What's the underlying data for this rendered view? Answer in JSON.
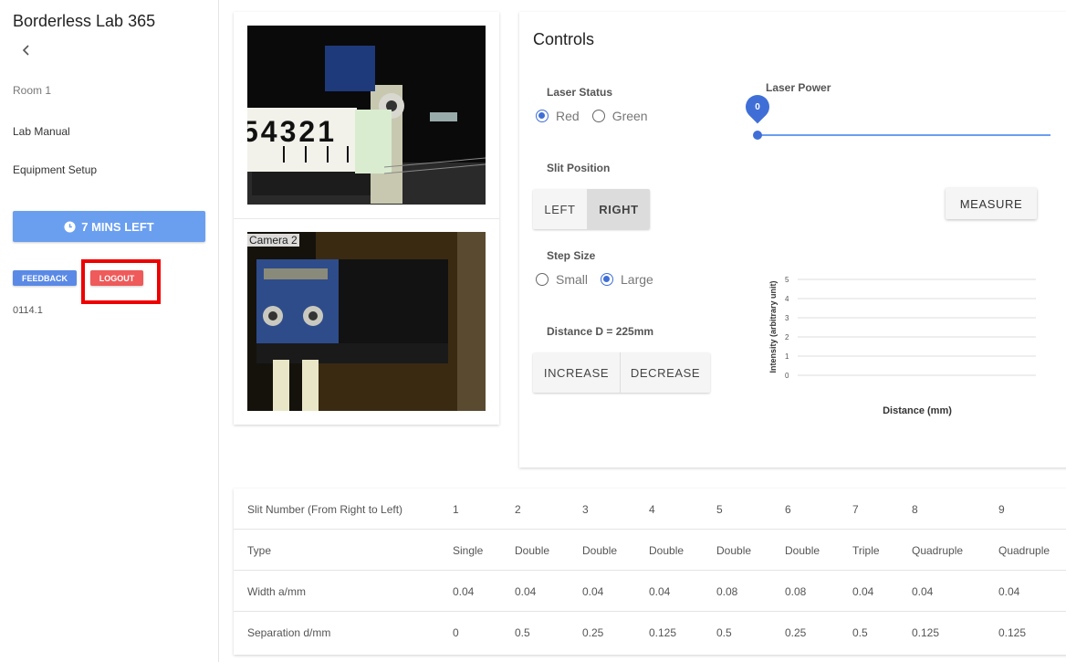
{
  "sidebar": {
    "app_title": "Borderless Lab 365",
    "back_icon": "chevron-left-icon",
    "room": "Room 1",
    "links": [
      "Lab Manual",
      "Equipment Setup"
    ],
    "timer_label": "7 MINS LEFT",
    "timer_icon": "clock-icon",
    "feedback_label": "FEEDBACK",
    "logout_label": "LOGOUT",
    "version": "0114.1"
  },
  "cameras": {
    "camera2_label": "Camera 2",
    "camera1_ruler_text": "54321"
  },
  "controls": {
    "title": "Controls",
    "laser_status_label": "Laser Status",
    "laser_options": [
      "Red",
      "Green"
    ],
    "laser_selected": "Red",
    "laser_power_label": "Laser Power",
    "laser_power_value": "0",
    "slit_position_label": "Slit Position",
    "slit_options": [
      "LEFT",
      "RIGHT"
    ],
    "slit_selected": "RIGHT",
    "measure_label": "MEASURE",
    "step_size_label": "Step Size",
    "step_options": [
      "Small",
      "Large"
    ],
    "step_selected": "Large",
    "distance_label": "Distance D = 225mm",
    "increase_label": "INCREASE",
    "decrease_label": "DECREASE"
  },
  "chart_data": {
    "type": "line",
    "title": "",
    "xlabel": "Distance (mm)",
    "ylabel": "Intensity (arbitrary unit)",
    "yticks": [
      "0",
      "1",
      "2",
      "3",
      "4",
      "5"
    ],
    "ylim": [
      0,
      5
    ],
    "grid": true,
    "series": []
  },
  "table": {
    "rows": [
      {
        "header": "Slit Number (From Right to Left)",
        "values": [
          "1",
          "2",
          "3",
          "4",
          "5",
          "6",
          "7",
          "8",
          "9"
        ]
      },
      {
        "header": "Type",
        "values": [
          "Single",
          "Double",
          "Double",
          "Double",
          "Double",
          "Double",
          "Triple",
          "Quadruple",
          "Quadruple"
        ]
      },
      {
        "header": "Width a/mm",
        "values": [
          "0.04",
          "0.04",
          "0.04",
          "0.04",
          "0.08",
          "0.08",
          "0.04",
          "0.04",
          "0.04"
        ]
      },
      {
        "header": "Separation d/mm",
        "values": [
          "0",
          "0.5",
          "0.25",
          "0.125",
          "0.5",
          "0.25",
          "0.5",
          "0.125",
          "0.125"
        ]
      }
    ]
  },
  "colors": {
    "accent_blue": "#3f6fd6",
    "timer_blue": "#6a9ff0",
    "logout_red": "#ef5a5a",
    "highlight_red": "#ee0000"
  }
}
